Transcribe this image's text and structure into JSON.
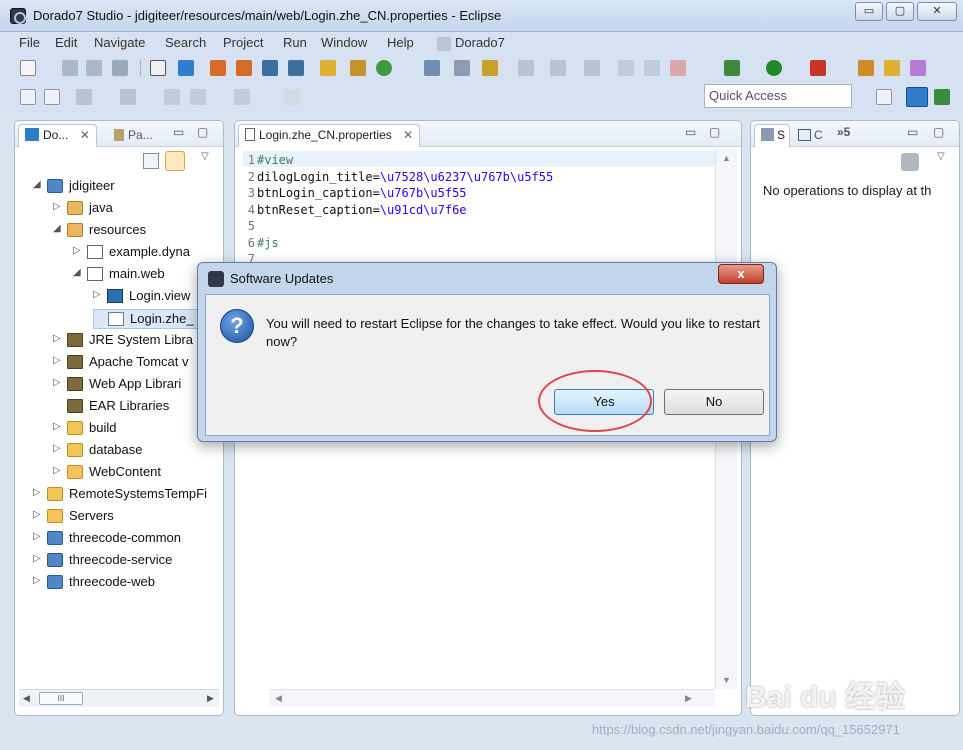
{
  "window": {
    "title": "Dorado7 Studio - jdigiteer/resources/main/web/Login.zhe_CN.properties - Eclipse",
    "minimize": "▭",
    "maximize": "▢",
    "close": "✕"
  },
  "menu": [
    "File",
    "Edit",
    "Navigate",
    "Search",
    "Project",
    "Run",
    "Window",
    "Help",
    "Dorado7"
  ],
  "quick_access": {
    "placeholder": "Quick Access"
  },
  "left_panel": {
    "tab_active": "Do...",
    "tab_active_close": "✕",
    "tab_inactive": "Pa...",
    "tree": [
      {
        "label": "jdigiteer",
        "arrow": "◢",
        "icon": "project-icon"
      },
      {
        "label": "java",
        "arrow": "▷",
        "icon": "package-folder-icon"
      },
      {
        "label": "resources",
        "arrow": "◢",
        "icon": "package-folder-icon"
      },
      {
        "label": "example.dyna",
        "arrow": "▷",
        "icon": "dyna-icon"
      },
      {
        "label": "main.web",
        "arrow": "◢",
        "icon": "dyna-icon"
      },
      {
        "label": "Login.view",
        "arrow": "▷",
        "icon": "view-file-icon"
      },
      {
        "label": "Login.zhe_",
        "arrow": "",
        "icon": "file-icon"
      },
      {
        "label": "JRE System Libra",
        "arrow": "▷",
        "icon": "library-icon"
      },
      {
        "label": "Apache Tomcat v",
        "arrow": "▷",
        "icon": "library-icon"
      },
      {
        "label": "Web App Librari",
        "arrow": "▷",
        "icon": "library-icon"
      },
      {
        "label": "EAR Libraries",
        "arrow": "",
        "icon": "library-icon"
      },
      {
        "label": "build",
        "arrow": "▷",
        "icon": "folder-icon"
      },
      {
        "label": "database",
        "arrow": "▷",
        "icon": "folder-icon"
      },
      {
        "label": "WebContent",
        "arrow": "▷",
        "icon": "folder-icon"
      },
      {
        "label": "RemoteSystemsTempFi",
        "arrow": "▷",
        "icon": "folder-icon"
      },
      {
        "label": "Servers",
        "arrow": "▷",
        "icon": "folder-icon"
      },
      {
        "label": "threecode-common",
        "arrow": "▷",
        "icon": "project-icon"
      },
      {
        "label": "threecode-service",
        "arrow": "▷",
        "icon": "project-icon"
      },
      {
        "label": "threecode-web",
        "arrow": "▷",
        "icon": "project-icon"
      }
    ],
    "hscroll_thumb": "III"
  },
  "editor": {
    "tab_label": "Login.zhe_CN.properties",
    "tab_close": "✕",
    "lines": [
      {
        "num": "1",
        "key": "#view",
        "val": ""
      },
      {
        "num": "2",
        "key": "dilogLogin_title=",
        "val": "\\u7528\\u6237\\u767b\\u5f55"
      },
      {
        "num": "3",
        "key": "btnLogin_caption=",
        "val": "\\u767b\\u5f55"
      },
      {
        "num": "4",
        "key": "btnReset_caption=",
        "val": "\\u91cd\\u7f6e"
      },
      {
        "num": "5",
        "key": "",
        "val": ""
      },
      {
        "num": "6",
        "key": "#js",
        "val": ""
      },
      {
        "num": "7",
        "key": "",
        "val": ""
      }
    ]
  },
  "right_panel": {
    "tab_s": "S",
    "tab_c": "C",
    "overflow": "»5",
    "message": "No operations to display at th"
  },
  "dialog": {
    "title": "Software Updates",
    "close": "x",
    "icon": "?",
    "message": "You will need to restart Eclipse for the changes to take effect. Would you like to restart now?",
    "yes": "Yes",
    "no": "No"
  },
  "watermarks": {
    "brand": "Bai du 经验",
    "url": "https://blog.csdn.net/jingyan.baidu.com/qq_15652971"
  },
  "colors": {
    "highlight_ring": "#e0454a",
    "accent": "#2a00ff"
  }
}
